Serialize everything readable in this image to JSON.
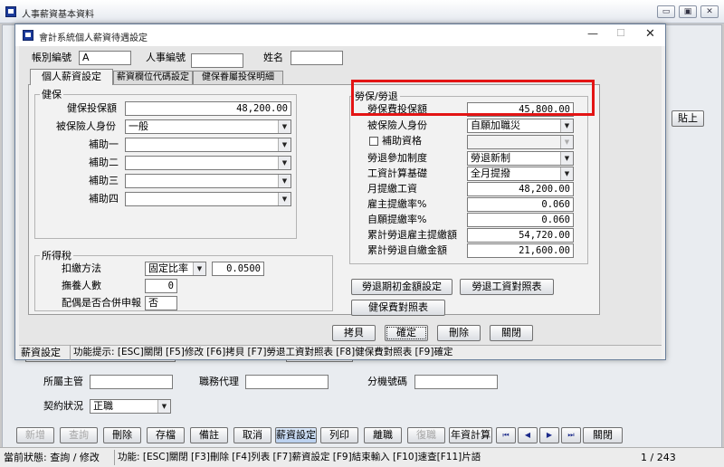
{
  "outer": {
    "title": "人事薪資基本資料",
    "win_controls": [
      "▭",
      "▣",
      "✕"
    ],
    "post_button": "貼上",
    "fields": {
      "supervisor_label": "所屬主管",
      "deputy_label": "職務代理",
      "ext_label": "分機號碼",
      "contract_label": "契約狀況",
      "contract_value": "正職"
    },
    "toolbar": [
      "新增",
      "查詢",
      "刪除",
      "存檔",
      "備註",
      "取消",
      "薪資設定",
      "列印",
      "離職",
      "復職",
      "年資計算"
    ],
    "nav": [
      "⏮",
      "◀",
      "▶",
      "⏭"
    ],
    "close_btn": "關閉",
    "status": {
      "text": "當前狀態: 查詢 / 修改",
      "hint": "功能: [ESC]關閉 [F3]刪除 [F4]列表 [F7]薪資設定 [F9]結束輸入 [F10]速查[F11]片語",
      "pager": "1 / 243"
    }
  },
  "dialog": {
    "title": "會計系統個人薪資待遇設定",
    "win_controls": [
      "—",
      "☐",
      "✕"
    ],
    "header": {
      "account_label": "帳別編號",
      "account_value": "A",
      "emp_no_label": "人事編號",
      "emp_no_value": "",
      "name_label": "姓名",
      "name_value": ""
    },
    "tabs": [
      "個人薪資設定",
      "薪資欄位代碼設定",
      "健保眷屬投保明細"
    ],
    "health": {
      "group_title": "健保",
      "premium_label": "健保投保額",
      "premium_value": "48,200.00",
      "identity_label": "被保險人身份",
      "identity_value": "一般",
      "subsidy_labels": [
        "補助一",
        "補助二",
        "補助三",
        "補助四"
      ]
    },
    "tax": {
      "group_title": "所得稅",
      "method_label": "扣繳方法",
      "method_value": "固定比率",
      "rate_value": "0.0500",
      "dependents_label": "撫養人數",
      "dependents_value": "0",
      "spouse_label": "配偶是否合併申報",
      "spouse_value": "否"
    },
    "labor": {
      "group_title": "勞保/勞退",
      "premium_label": "勞保費投保額",
      "premium_value": "45,800.00",
      "identity_label": "被保險人身份",
      "identity_value": "自願加職災",
      "subsidy_check_label": "補助資格",
      "pension_label": "勞退參加制度",
      "pension_value": "勞退新制",
      "wage_basis_label": "工資計算基礎",
      "wage_basis_value": "全月提撥",
      "monthly_wage_label": "月提繳工資",
      "monthly_wage_value": "48,200.00",
      "employer_rate_label": "雇主提繳率%",
      "employer_rate_value": "0.060",
      "self_rate_label": "自願提繳率%",
      "self_rate_value": "0.060",
      "cum_employer_label": "累計勞退雇主提繳額",
      "cum_employer_value": "54,720.00",
      "cum_self_label": "累計勞退自繳金額",
      "cum_self_value": "21,600.00"
    },
    "action_buttons": {
      "pension_init": "勞退期初金額設定",
      "pension_table": "勞退工資對照表",
      "health_table": "健保費對照表"
    },
    "bottom_buttons": [
      "拷貝",
      "確定",
      "刪除",
      "關閉"
    ],
    "status": {
      "mode": "薪資設定",
      "hint": "功能提示: [ESC]關閉 [F5]修改 [F6]拷貝 [F7]勞退工資對照表 [F8]健保費對照表 [F9]確定"
    }
  },
  "colors": {
    "highlight": "#e31414",
    "dialog_border": "#6a7f9a",
    "brand_logo": "#1c3b9b"
  }
}
